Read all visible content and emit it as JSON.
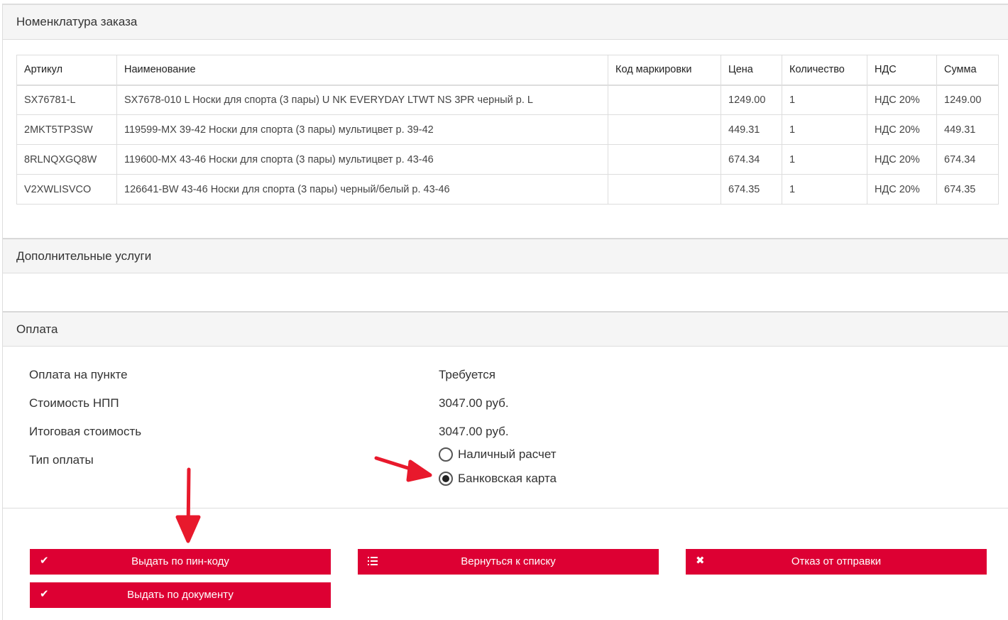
{
  "sections": {
    "nomenclature_title": "Номенклатура заказа",
    "services_title": "Дополнительные услуги",
    "payment_title": "Оплата"
  },
  "items_table": {
    "headers": [
      "Артикул",
      "Наименование",
      "Код маркировки",
      "Цена",
      "Количество",
      "НДС",
      "Сумма"
    ],
    "rows": [
      [
        "SX76781-L",
        "SX7678-010 L Носки для спорта (3 пары) U NK EVERYDAY LTWT NS 3PR черный р. L",
        "",
        "1249.00",
        "1",
        "НДС 20%",
        "1249.00"
      ],
      [
        "2MKT5TP3SW",
        "119599-MX 39-42 Носки для спорта (3 пары) мультицвет р. 39-42",
        "",
        "449.31",
        "1",
        "НДС 20%",
        "449.31"
      ],
      [
        "8RLNQXGQ8W",
        "119600-MX 43-46 Носки для спорта (3 пары) мультицвет р. 43-46",
        "",
        "674.34",
        "1",
        "НДС 20%",
        "674.34"
      ],
      [
        "V2XWLISVCO",
        "126641-BW 43-46 Носки для спорта (3 пары) черный/белый р. 43-46",
        "",
        "674.35",
        "1",
        "НДС 20%",
        "674.35"
      ]
    ]
  },
  "payment": {
    "on_point_label": "Оплата на пункте",
    "on_point_value": "Требуется",
    "npp_cost_label": "Стоимость НПП",
    "npp_cost_value": "3047.00 руб.",
    "total_cost_label": "Итоговая стоимость",
    "total_cost_value": "3047.00 руб.",
    "payment_type_label": "Тип оплаты",
    "options": [
      {
        "label": "Наличный расчет",
        "selected": false
      },
      {
        "label": "Банковская карта",
        "selected": true
      }
    ]
  },
  "buttons": {
    "issue_by_pin": "Выдать по пин-коду",
    "back_to_list": "Вернуться к списку",
    "refuse_shipment": "Отказ от отправки",
    "issue_by_document": "Выдать по документу"
  },
  "icons": {
    "check": "check-icon",
    "list": "list-icon",
    "close": "close-icon"
  },
  "colors": {
    "button_bg": "#dd0033",
    "annotation_arrow": "#e8192c",
    "header_bg": "#f5f5f5",
    "border": "#dddddd"
  }
}
